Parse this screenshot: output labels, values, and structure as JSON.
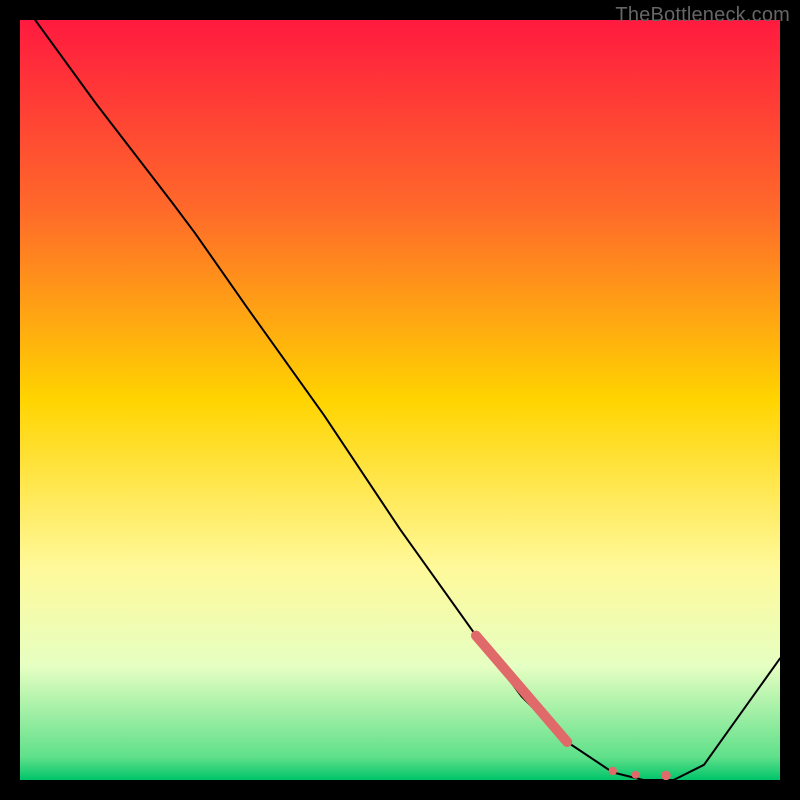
{
  "watermark": "TheBottleneck.com",
  "chart_data": {
    "type": "line",
    "title": "",
    "xlabel": "",
    "ylabel": "",
    "xlim": [
      0,
      100
    ],
    "ylim": [
      0,
      100
    ],
    "gradient_stops": [
      {
        "offset": 0,
        "color": "#ff1a3f"
      },
      {
        "offset": 0.25,
        "color": "#ff6a2a"
      },
      {
        "offset": 0.5,
        "color": "#ffd400"
      },
      {
        "offset": 0.72,
        "color": "#fff99a"
      },
      {
        "offset": 0.85,
        "color": "#e6ffc2"
      },
      {
        "offset": 0.97,
        "color": "#5fe08a"
      },
      {
        "offset": 1.0,
        "color": "#00c46a"
      }
    ],
    "series": [
      {
        "name": "curve",
        "color": "#000000",
        "x": [
          2,
          10,
          20,
          23,
          30,
          40,
          50,
          60,
          66,
          72,
          78,
          82,
          86,
          90,
          100
        ],
        "y": [
          100,
          89,
          76,
          72,
          62,
          48,
          33,
          19,
          11,
          5,
          1,
          0,
          0,
          2,
          16
        ]
      }
    ],
    "overlay_points": {
      "color": "#e06a6a",
      "segment": {
        "x1": 60,
        "y1": 19,
        "x2": 72,
        "y2": 5,
        "width": 10
      },
      "dots": [
        {
          "x": 78,
          "y": 1.2,
          "r": 4.2
        },
        {
          "x": 81,
          "y": 0.7,
          "r": 4.0
        },
        {
          "x": 85,
          "y": 0.6,
          "r": 4.8
        }
      ]
    }
  }
}
